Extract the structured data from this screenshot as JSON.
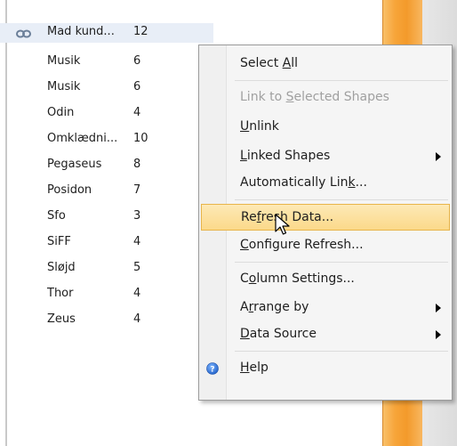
{
  "list": {
    "partial_label": "...",
    "rows": [
      {
        "name": "Mad kund...",
        "count": "12",
        "selected": true,
        "linked": true
      },
      {
        "name": "Musik",
        "count": "6"
      },
      {
        "name": "Musik",
        "count": "6"
      },
      {
        "name": "Odin",
        "count": "4"
      },
      {
        "name": "Omklædni...",
        "count": "10"
      },
      {
        "name": "Pegaseus",
        "count": "8"
      },
      {
        "name": "Posidon",
        "count": "7"
      },
      {
        "name": "Sfo",
        "count": "3"
      },
      {
        "name": "SiFF",
        "count": "4"
      },
      {
        "name": "Sløjd",
        "count": "5"
      },
      {
        "name": "Thor",
        "count": "4"
      },
      {
        "name": "Zeus",
        "count": "4"
      }
    ]
  },
  "menu": {
    "items": [
      {
        "id": "select-all",
        "pre": "Select ",
        "acc": "A",
        "post": "ll"
      },
      {
        "id": "link-to-selected",
        "pre": "Link to ",
        "acc": "S",
        "post": "elected Shapes",
        "disabled": true
      },
      {
        "id": "unlink",
        "pre": "",
        "acc": "U",
        "post": "nlink"
      },
      {
        "id": "linked-shapes",
        "pre": "",
        "acc": "L",
        "post": "inked Shapes",
        "submenu": true
      },
      {
        "id": "automatically-link",
        "pre": "Automatically Lin",
        "acc": "k",
        "post": "..."
      },
      {
        "id": "refresh-data",
        "pre": "Re",
        "acc": "f",
        "post": "resh Data...",
        "highlight": true
      },
      {
        "id": "configure-refresh",
        "pre": "",
        "acc": "C",
        "post": "onfigure Refresh..."
      },
      {
        "id": "column-settings",
        "pre": "C",
        "acc": "o",
        "post": "lumn Settings..."
      },
      {
        "id": "arrange-by",
        "pre": "A",
        "acc": "r",
        "post": "range by",
        "submenu": true
      },
      {
        "id": "data-source",
        "pre": "",
        "acc": "D",
        "post": "ata Source",
        "submenu": true
      },
      {
        "id": "help",
        "pre": "",
        "acc": "H",
        "post": "elp"
      }
    ]
  },
  "colors": {
    "accent_highlight": "#fbd98a",
    "orange_bar": "#f39a2b"
  }
}
